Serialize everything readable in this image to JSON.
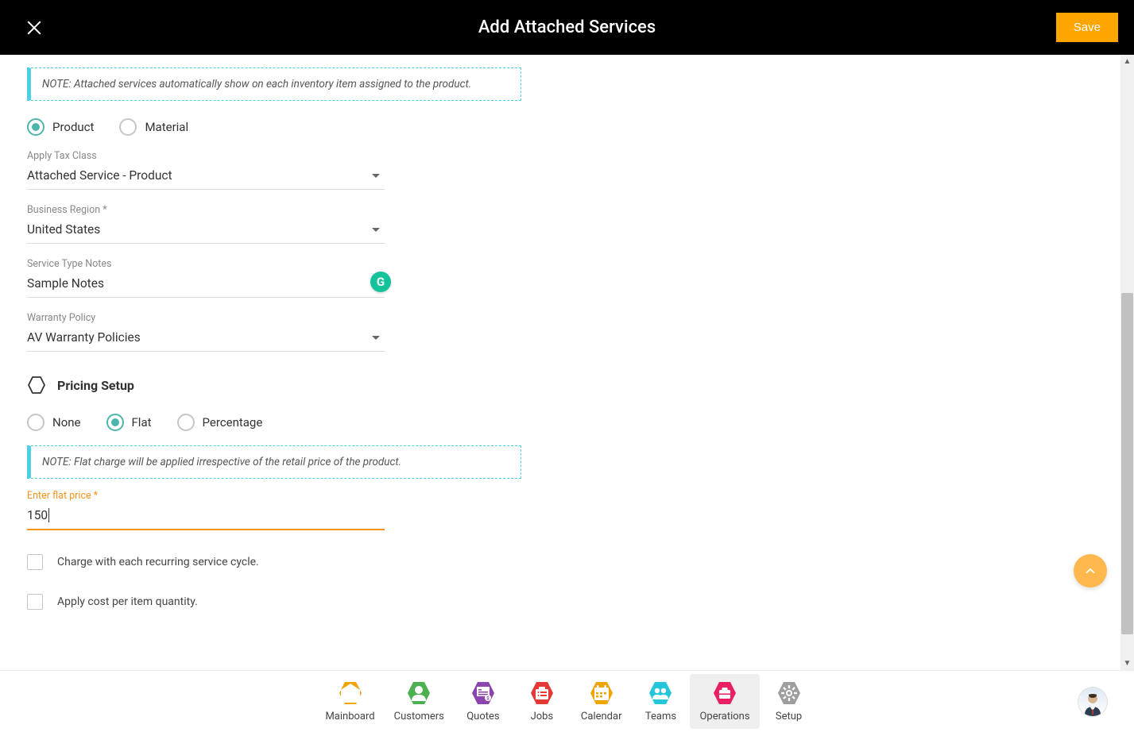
{
  "header": {
    "title": "Add Attached Services",
    "save_label": "Save"
  },
  "notes": {
    "attached_info": "NOTE: Attached services automatically show on each inventory item assigned to the product.",
    "flat_info": "NOTE: Flat charge will be applied irrespective of the retail price of the product."
  },
  "service_type": {
    "radios": {
      "product_label": "Product",
      "material_label": "Material",
      "selected": "product"
    }
  },
  "fields": {
    "tax_class": {
      "label": "Apply Tax Class",
      "value": "Attached Service - Product"
    },
    "business_region": {
      "label": "Business Region *",
      "value": "United States"
    },
    "notes": {
      "label": "Service Type Notes",
      "value": "Sample Notes"
    },
    "warranty": {
      "label": "Warranty Policy",
      "value": "AV Warranty Policies"
    },
    "flat_price": {
      "label": "Enter flat price *",
      "value": "150"
    }
  },
  "pricing": {
    "section_title": "Pricing Setup",
    "radios": {
      "none_label": "None",
      "flat_label": "Flat",
      "percentage_label": "Percentage",
      "selected": "flat"
    },
    "checkbox_recurring": "Charge with each recurring service cycle.",
    "checkbox_per_item": "Apply cost per item quantity."
  },
  "nav": {
    "items": [
      {
        "id": "mainboard",
        "label": "Mainboard",
        "color": "#f0a400"
      },
      {
        "id": "customers",
        "label": "Customers",
        "color": "#4caf50"
      },
      {
        "id": "quotes",
        "label": "Quotes",
        "color": "#8e44ad"
      },
      {
        "id": "jobs",
        "label": "Jobs",
        "color": "#e53935"
      },
      {
        "id": "calendar",
        "label": "Calendar",
        "color": "#f0a400"
      },
      {
        "id": "teams",
        "label": "Teams",
        "color": "#26c6da"
      },
      {
        "id": "operations",
        "label": "Operations",
        "color": "#e91e63"
      },
      {
        "id": "setup",
        "label": "Setup",
        "color": "#9e9e9e"
      }
    ],
    "active": "operations"
  }
}
